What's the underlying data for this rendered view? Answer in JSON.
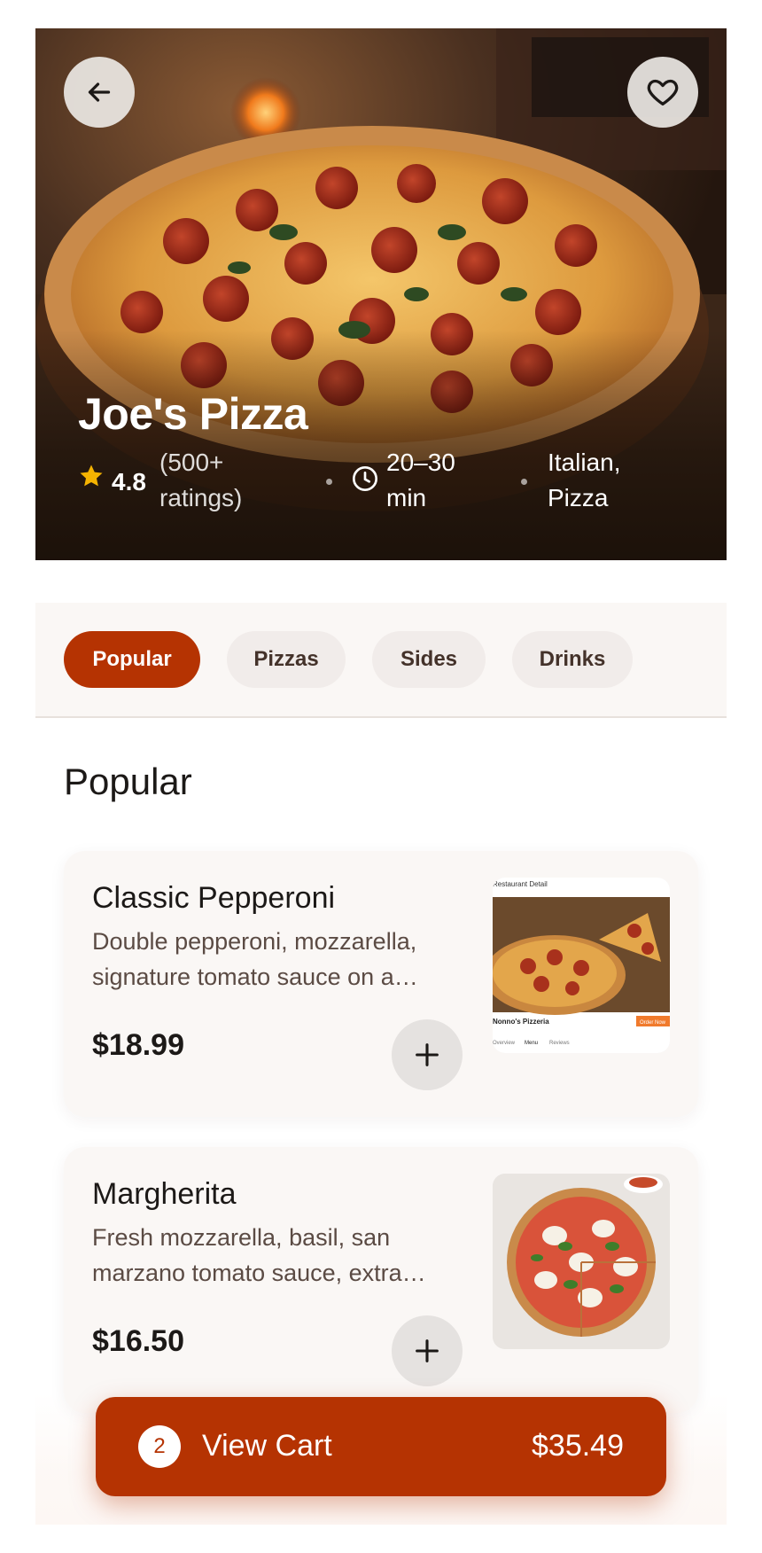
{
  "restaurant": {
    "name": "Joe's Pizza",
    "rating": "4.8",
    "ratings_count": "(500+ ratings)",
    "delivery_time": "20–30 min",
    "cuisine": "Italian, Pizza"
  },
  "header": {
    "back_icon": "arrow-left-icon",
    "favorite_icon": "heart-icon"
  },
  "tabs": [
    {
      "label": "Popular",
      "active": true
    },
    {
      "label": "Pizzas",
      "active": false
    },
    {
      "label": "Sides",
      "active": false
    },
    {
      "label": "Drinks",
      "active": false
    }
  ],
  "section": {
    "title": "Popular"
  },
  "menu_items": [
    {
      "name": "Classic Pepperoni",
      "description": "Double pepperoni, mozzarella, signature tomato sauce on a hand-tossed crust",
      "price": "$18.99",
      "thumbnail": {
        "header": "Restaurant Detail",
        "restaurant": "Nonno's Pizzeria",
        "order_label": "Order Now",
        "tabs": [
          "Overview",
          "Menu",
          "Reviews"
        ]
      }
    },
    {
      "name": "Margherita",
      "description": "Fresh mozzarella, basil, san marzano tomato sauce, extra virgin olive oil",
      "price": "$16.50"
    }
  ],
  "cart": {
    "count": "2",
    "label": "View Cart",
    "total": "$35.49"
  },
  "colors": {
    "accent": "#b53302",
    "tab_inactive_bg": "#f1ecea",
    "card_bg": "#faf7f5"
  }
}
